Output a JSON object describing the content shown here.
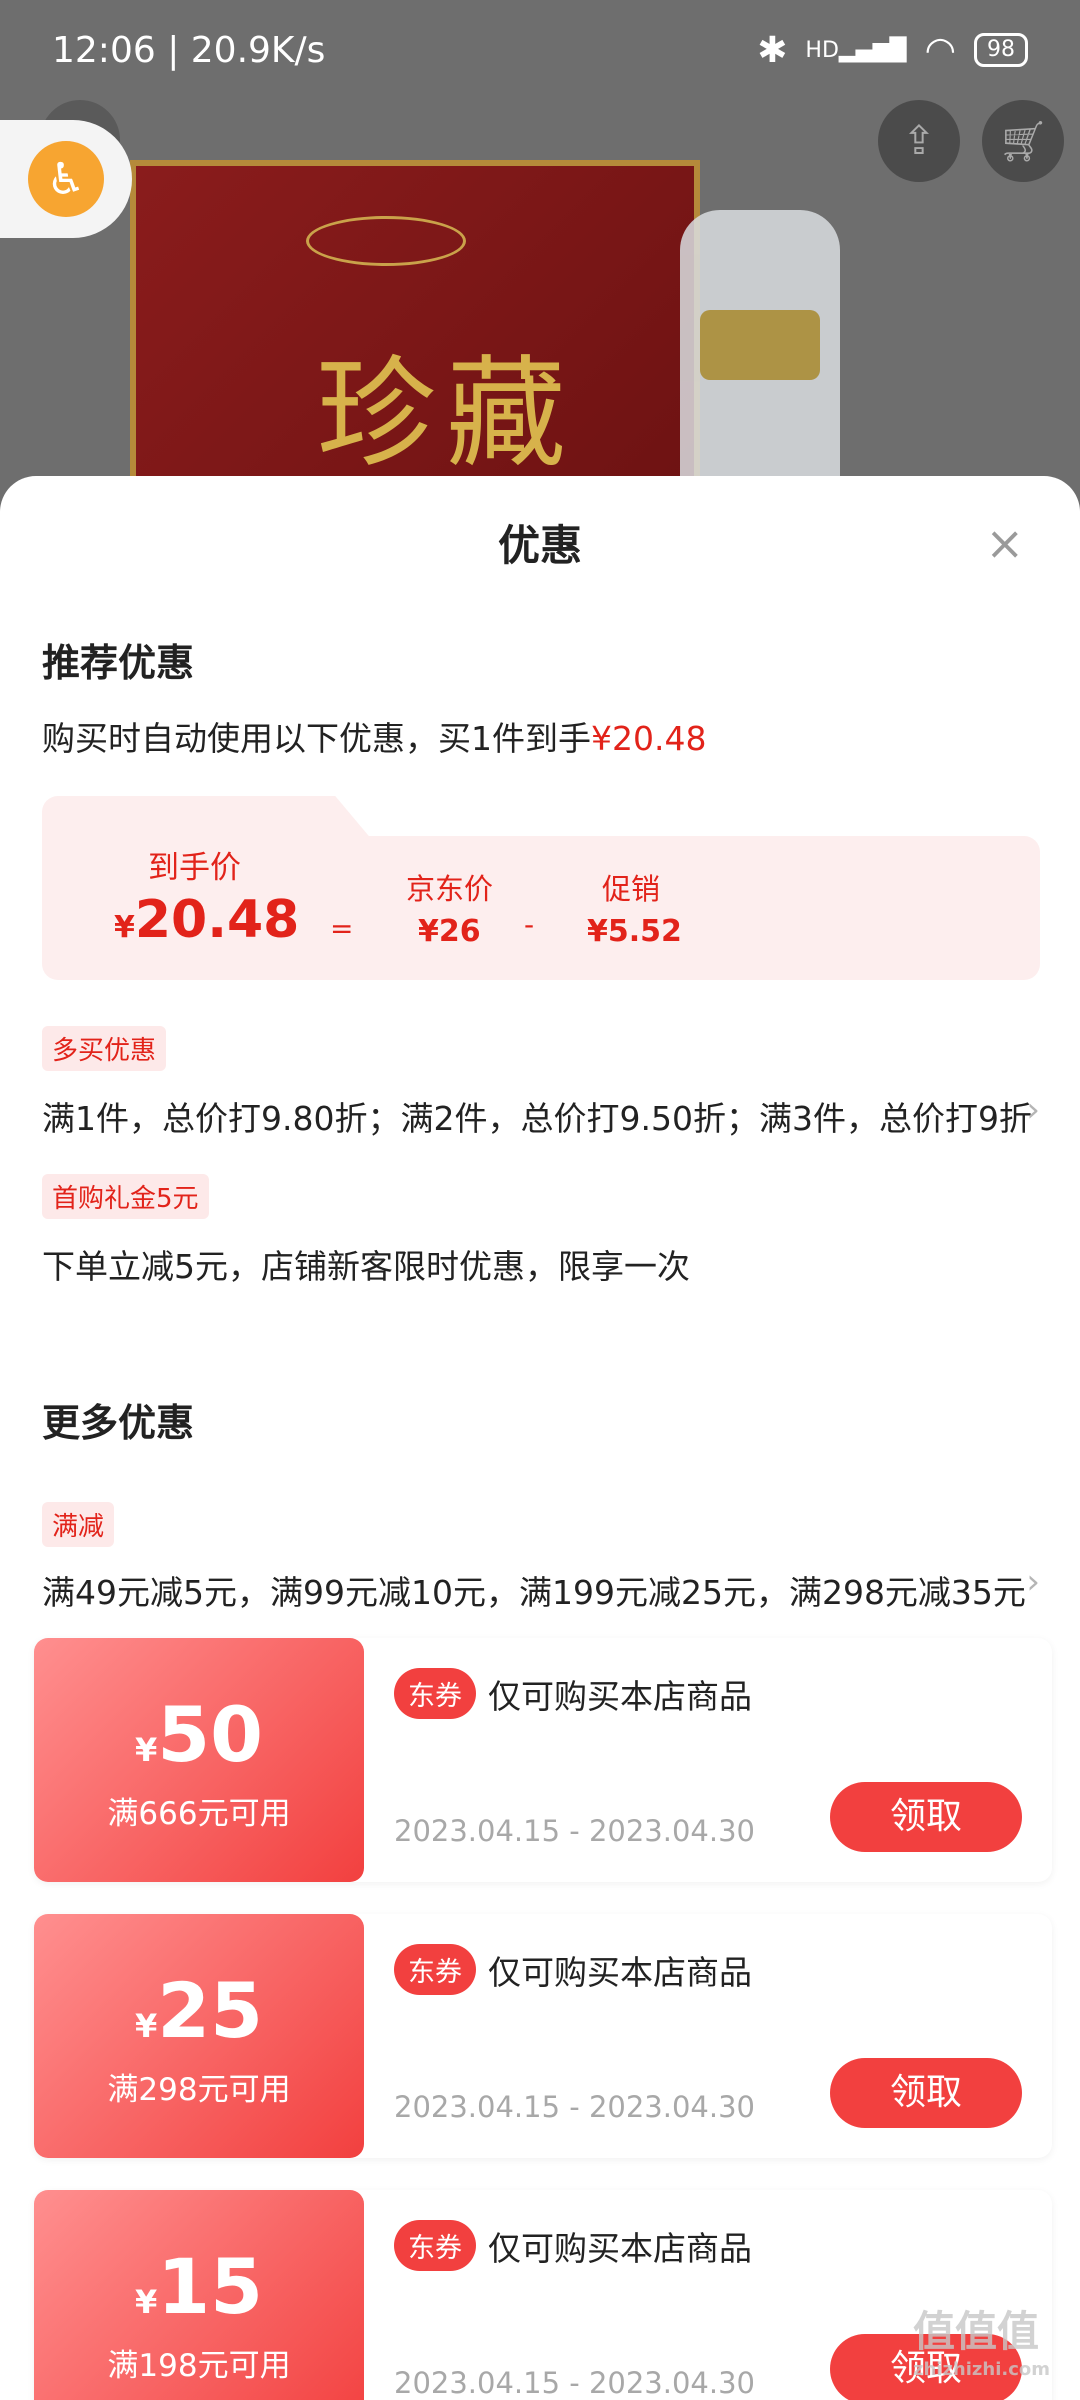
{
  "status_bar": {
    "time_speed": "12:06 | 20.9K/s",
    "battery": "98",
    "network": "HD"
  },
  "product": {
    "box_text": "珍藏"
  },
  "sheet": {
    "title": "优惠",
    "close": "×"
  },
  "recommended": {
    "title": "推荐优惠",
    "summary_prefix": "购买时自动使用以下优惠，买1件到手",
    "summary_price": "¥20.48",
    "final_label": "到手价",
    "final_symbol": "¥",
    "final_value": "20.48",
    "eq": "=",
    "jd_label": "京东价",
    "jd_value": "¥26",
    "minus": "-",
    "promo_label": "促销",
    "promo_value": "¥5.52"
  },
  "promotions": [
    {
      "tag": "多买优惠",
      "text": "满1件，总价打9.80折；满2件，总价打9.50折；满3件，总价打9折"
    },
    {
      "tag": "首购礼金5元",
      "text": "下单立减5元，店铺新客限时优惠，限享一次"
    }
  ],
  "more": {
    "title": "更多优惠",
    "tag": "满减",
    "text": "满49元减5元，满99元减10元，满199元减25元，满298元减35元"
  },
  "coupons": [
    {
      "symbol": "¥",
      "amount": "50",
      "condition": "满666元可用",
      "badge": "东券",
      "desc": "仅可购买本店商品",
      "date": "2023.04.15 - 2023.04.30",
      "button": "领取"
    },
    {
      "symbol": "¥",
      "amount": "25",
      "condition": "满298元可用",
      "badge": "东券",
      "desc": "仅可购买本店商品",
      "date": "2023.04.15 - 2023.04.30",
      "button": "领取"
    },
    {
      "symbol": "¥",
      "amount": "15",
      "condition": "满198元可用",
      "badge": "东券",
      "desc": "仅可购买本店商品",
      "date": "2023.04.15 - 2023.04.30",
      "button": "领取"
    }
  ],
  "watermark": {
    "main": "值值值",
    "sub": "zhizhizhi.com"
  },
  "colors": {
    "accent": "#e2231a",
    "coupon_red": "#f2403f",
    "a11y": "#f7a531"
  }
}
